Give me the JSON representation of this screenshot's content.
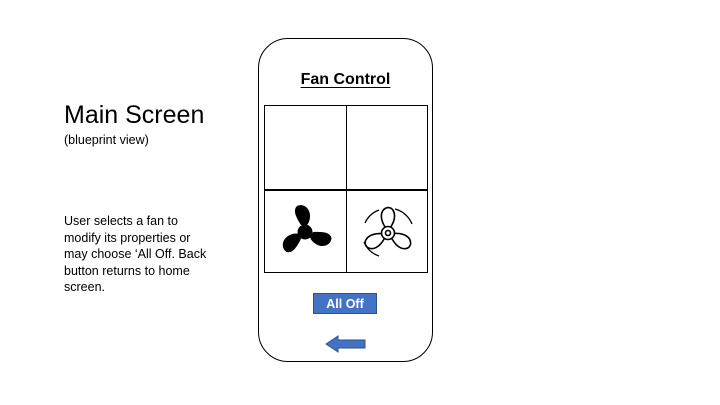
{
  "slide": {
    "title": "Main Screen",
    "subtitle": "(blueprint view)",
    "description": "User selects a fan to modify its properties or may choose ‘All Off. Back button returns to home screen."
  },
  "phone": {
    "screen_title": "Fan Control",
    "fans": [
      {
        "icon": "fan-solid-icon"
      },
      {
        "icon": "fan-outline-icon"
      }
    ],
    "all_off_label": "All Off",
    "back_icon": "left-arrow-icon"
  },
  "colors": {
    "button_blue": "#4472C4",
    "text": "#000000"
  }
}
